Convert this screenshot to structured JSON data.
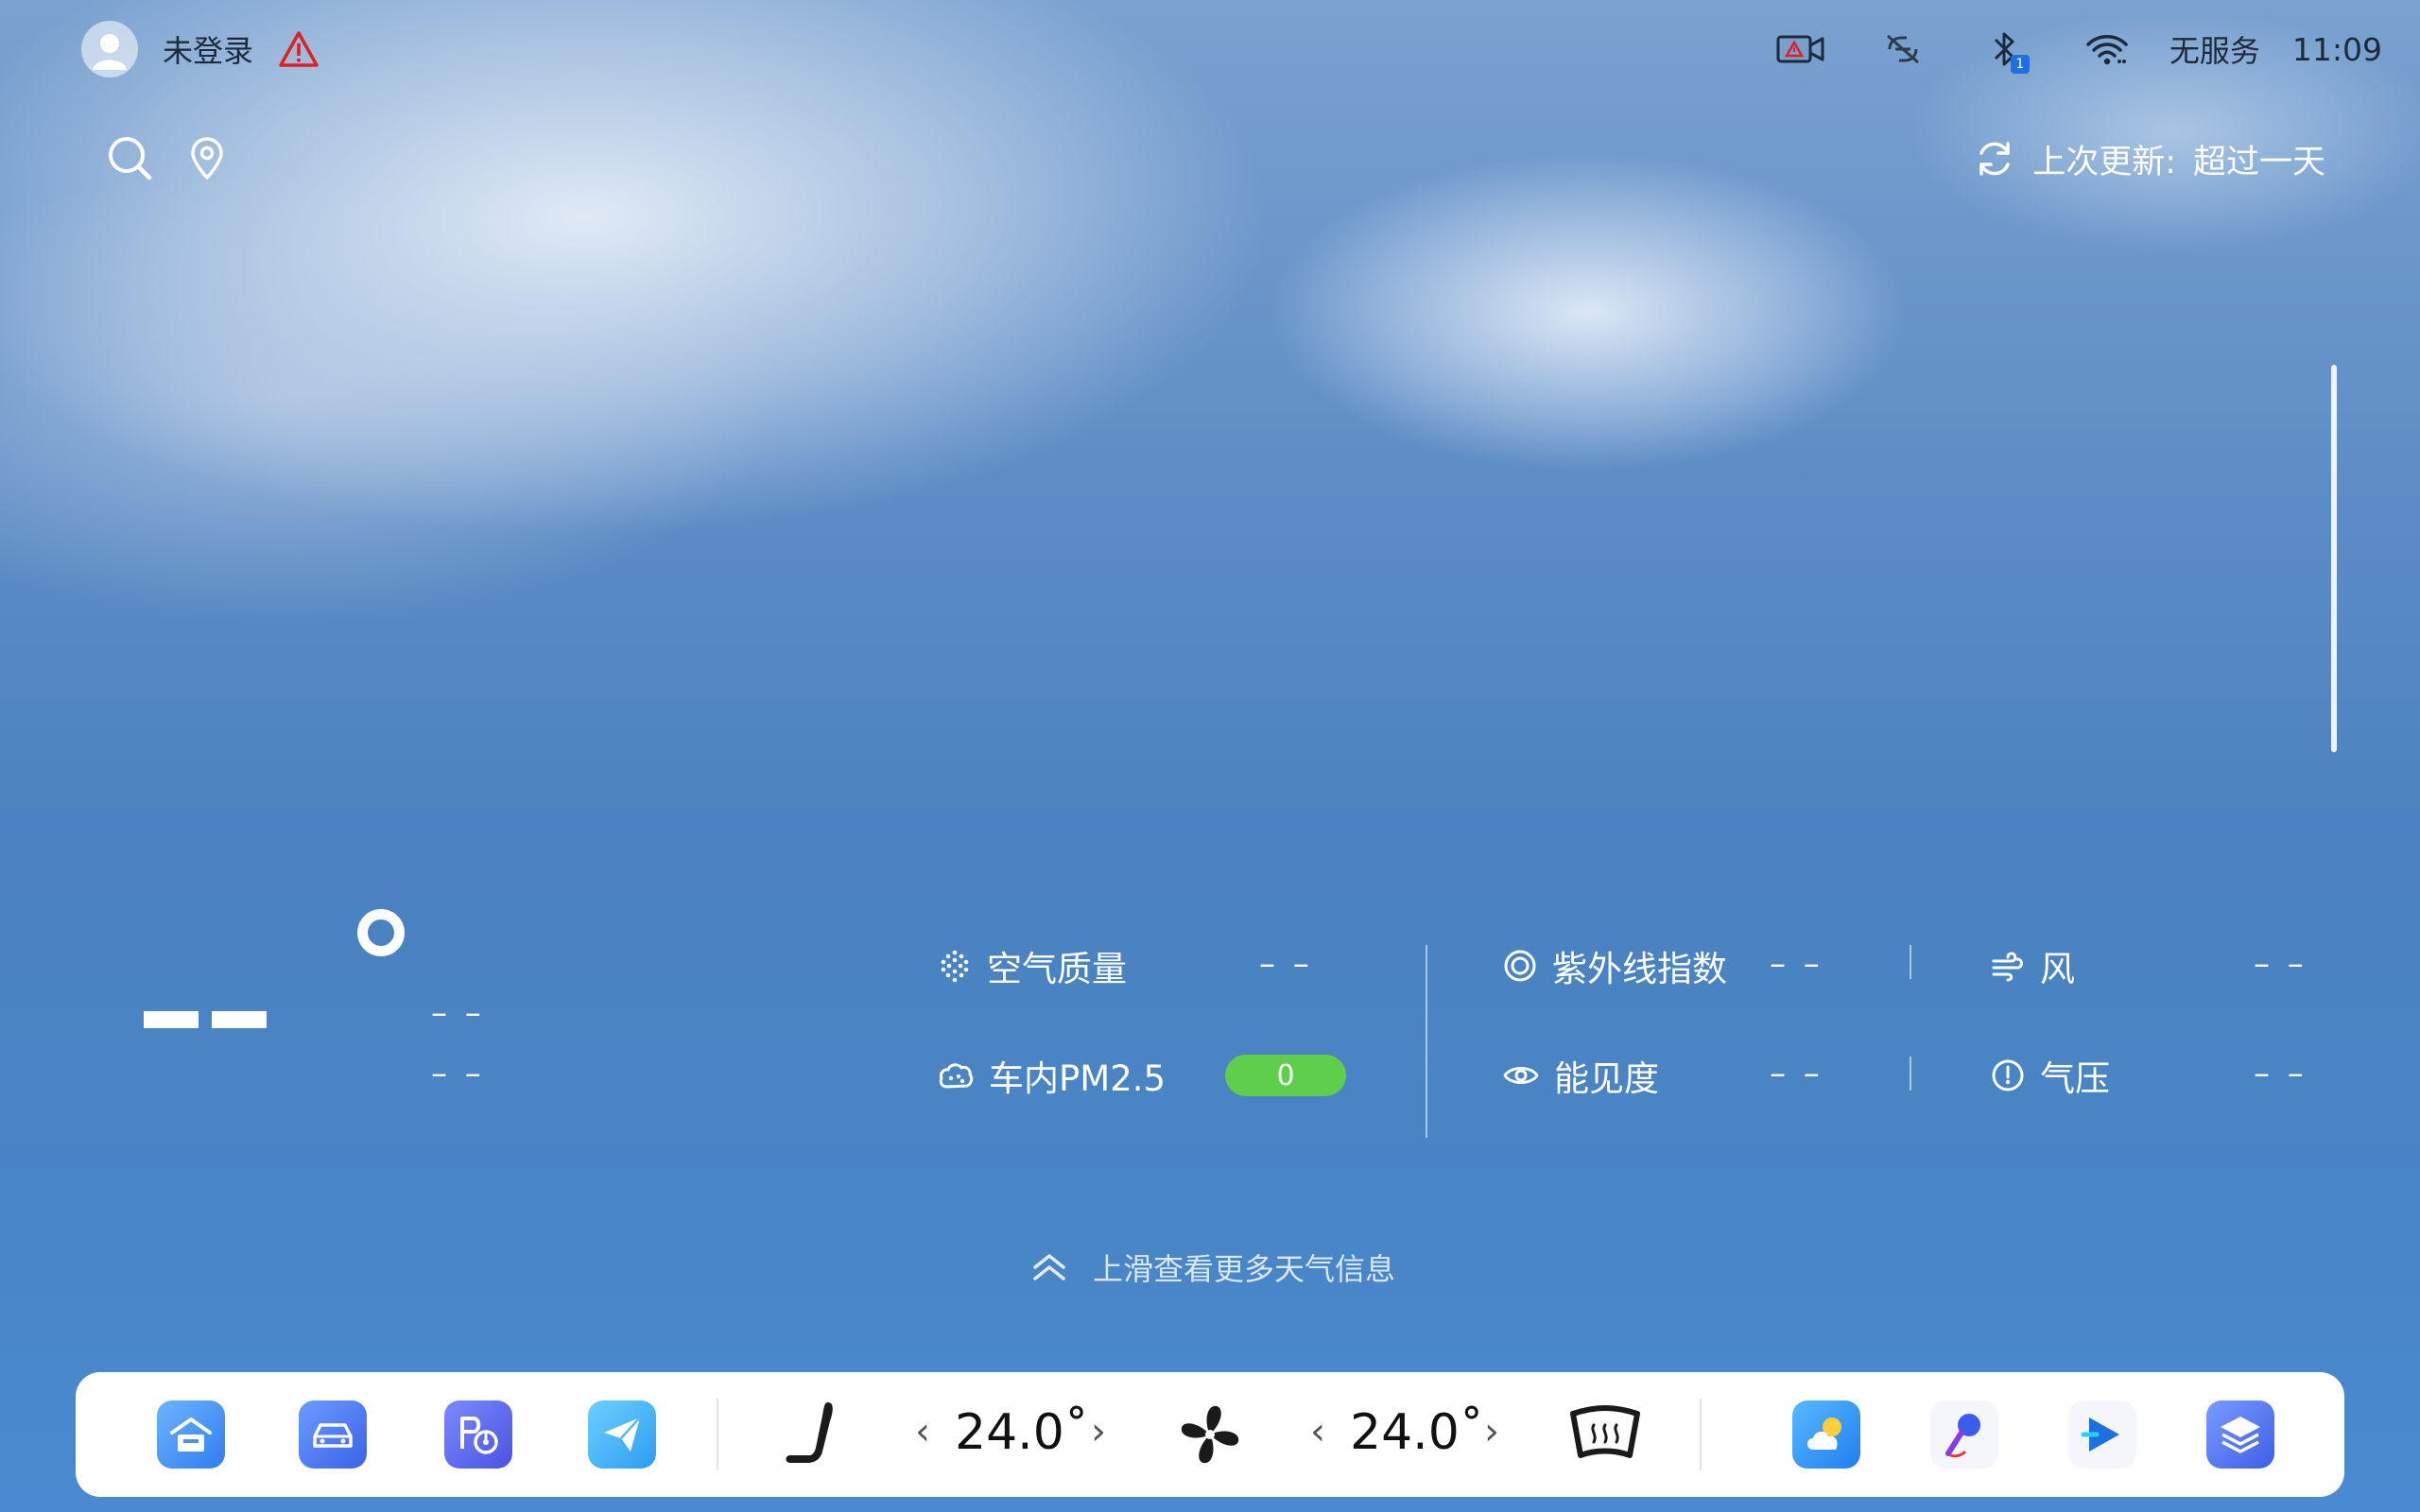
{
  "status_bar": {
    "user_label": "未登录",
    "signal_label": "无服务",
    "time": "11:09",
    "bluetooth_badge": "1",
    "icons": [
      "avatar",
      "warning-icon",
      "camera-alert-icon",
      "link-off-icon",
      "bluetooth-icon",
      "wifi-icon"
    ]
  },
  "header": {
    "update_label": "上次更新:",
    "update_value": "超过一天",
    "icons": [
      "search-icon",
      "location-pin-icon",
      "refresh-icon"
    ]
  },
  "temperature": {
    "current": "--",
    "high": "– –",
    "low": "– –"
  },
  "metrics": {
    "air_quality": {
      "label": "空气质量",
      "value": "– –"
    },
    "cabin_pm25": {
      "label": "车内PM2.5",
      "value": "0"
    },
    "uv_index": {
      "label": "紫外线指数",
      "value": "– –"
    },
    "visibility": {
      "label": "能见度",
      "value": "– –"
    },
    "wind": {
      "label": "风",
      "value": "– –"
    },
    "pressure": {
      "label": "气压",
      "value": "– –"
    }
  },
  "swipe_hint": "上滑查看更多天气信息",
  "dock": {
    "left_temp": "24.0˚",
    "right_temp": "24.0˚",
    "apps_left": [
      "home-app-icon",
      "car-app-icon",
      "parking-app-icon",
      "send-app-icon"
    ],
    "apps_right": [
      "weather-app-icon",
      "karaoke-app-icon",
      "video-app-icon",
      "layers-app-icon"
    ]
  },
  "colors": {
    "pm_badge": "#5fce4a",
    "warning": "#e02020",
    "bluetooth_badge": "#1e6fe0"
  }
}
